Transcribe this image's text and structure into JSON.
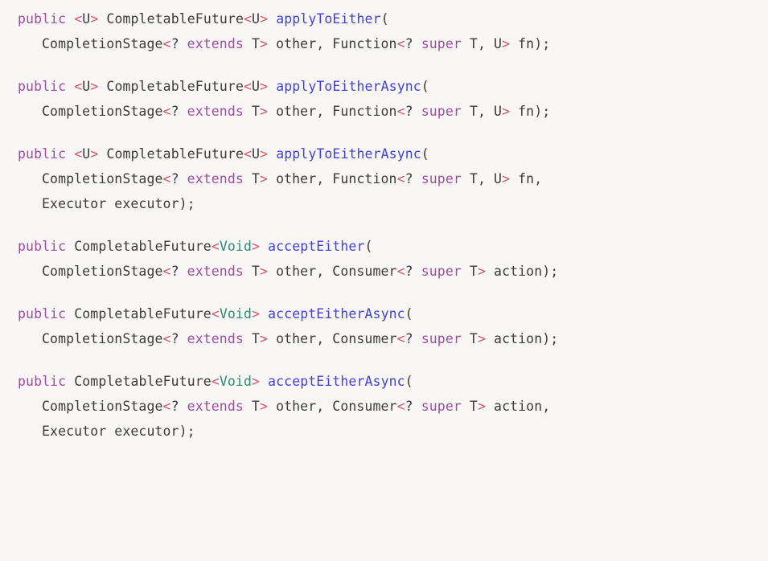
{
  "document": {
    "title": "CompletableFuture applyToEither / acceptEither API signatures",
    "language": "java",
    "background_color": "#f8f7f6"
  },
  "theme": {
    "keyword_color": "#9b4f9e",
    "method_color": "#4040dd",
    "type_color": "#3b3b3b",
    "void_color": "#2d8b74",
    "angle_bracket_color": "#d2566a",
    "plain_color": "#3b3b3b"
  },
  "blocks": [
    {
      "id": "applyToEither",
      "lines": [
        {
          "indent": false,
          "tokens": [
            {
              "t": "public",
              "k": "kw"
            },
            {
              "t": " ",
              "k": "plain"
            },
            {
              "t": "<",
              "k": "angle"
            },
            {
              "t": "U",
              "k": "type"
            },
            {
              "t": ">",
              "k": "angle"
            },
            {
              "t": " CompletableFuture",
              "k": "type"
            },
            {
              "t": "<",
              "k": "angle"
            },
            {
              "t": "U",
              "k": "type"
            },
            {
              "t": ">",
              "k": "angle"
            },
            {
              "t": " ",
              "k": "plain"
            },
            {
              "t": "applyToEither",
              "k": "method"
            },
            {
              "t": "(",
              "k": "plain"
            }
          ]
        },
        {
          "indent": true,
          "tokens": [
            {
              "t": "CompletionStage",
              "k": "type"
            },
            {
              "t": "<",
              "k": "angle"
            },
            {
              "t": "?",
              "k": "plain"
            },
            {
              "t": " ",
              "k": "plain"
            },
            {
              "t": "extends",
              "k": "kw"
            },
            {
              "t": " T",
              "k": "type"
            },
            {
              "t": ">",
              "k": "angle"
            },
            {
              "t": " other, Function",
              "k": "plain"
            },
            {
              "t": "<",
              "k": "angle"
            },
            {
              "t": "?",
              "k": "plain"
            },
            {
              "t": " ",
              "k": "plain"
            },
            {
              "t": "super",
              "k": "kw"
            },
            {
              "t": " T, U",
              "k": "type"
            },
            {
              "t": ">",
              "k": "angle"
            },
            {
              "t": " fn);",
              "k": "plain"
            }
          ]
        }
      ]
    },
    {
      "id": "applyToEitherAsync",
      "lines": [
        {
          "indent": false,
          "tokens": [
            {
              "t": "public",
              "k": "kw"
            },
            {
              "t": " ",
              "k": "plain"
            },
            {
              "t": "<",
              "k": "angle"
            },
            {
              "t": "U",
              "k": "type"
            },
            {
              "t": ">",
              "k": "angle"
            },
            {
              "t": " CompletableFuture",
              "k": "type"
            },
            {
              "t": "<",
              "k": "angle"
            },
            {
              "t": "U",
              "k": "type"
            },
            {
              "t": ">",
              "k": "angle"
            },
            {
              "t": " ",
              "k": "plain"
            },
            {
              "t": "applyToEitherAsync",
              "k": "method"
            },
            {
              "t": "(",
              "k": "plain"
            }
          ]
        },
        {
          "indent": true,
          "tokens": [
            {
              "t": "CompletionStage",
              "k": "type"
            },
            {
              "t": "<",
              "k": "angle"
            },
            {
              "t": "?",
              "k": "plain"
            },
            {
              "t": " ",
              "k": "plain"
            },
            {
              "t": "extends",
              "k": "kw"
            },
            {
              "t": " T",
              "k": "type"
            },
            {
              "t": ">",
              "k": "angle"
            },
            {
              "t": " other, Function",
              "k": "plain"
            },
            {
              "t": "<",
              "k": "angle"
            },
            {
              "t": "?",
              "k": "plain"
            },
            {
              "t": " ",
              "k": "plain"
            },
            {
              "t": "super",
              "k": "kw"
            },
            {
              "t": " T, U",
              "k": "type"
            },
            {
              "t": ">",
              "k": "angle"
            },
            {
              "t": " fn);",
              "k": "plain"
            }
          ]
        }
      ]
    },
    {
      "id": "applyToEitherAsync-executor",
      "lines": [
        {
          "indent": false,
          "tokens": [
            {
              "t": "public",
              "k": "kw"
            },
            {
              "t": " ",
              "k": "plain"
            },
            {
              "t": "<",
              "k": "angle"
            },
            {
              "t": "U",
              "k": "type"
            },
            {
              "t": ">",
              "k": "angle"
            },
            {
              "t": " CompletableFuture",
              "k": "type"
            },
            {
              "t": "<",
              "k": "angle"
            },
            {
              "t": "U",
              "k": "type"
            },
            {
              "t": ">",
              "k": "angle"
            },
            {
              "t": " ",
              "k": "plain"
            },
            {
              "t": "applyToEitherAsync",
              "k": "method"
            },
            {
              "t": "(",
              "k": "plain"
            }
          ]
        },
        {
          "indent": true,
          "tokens": [
            {
              "t": "CompletionStage",
              "k": "type"
            },
            {
              "t": "<",
              "k": "angle"
            },
            {
              "t": "?",
              "k": "plain"
            },
            {
              "t": " ",
              "k": "plain"
            },
            {
              "t": "extends",
              "k": "kw"
            },
            {
              "t": " T",
              "k": "type"
            },
            {
              "t": ">",
              "k": "angle"
            },
            {
              "t": " other, Function",
              "k": "plain"
            },
            {
              "t": "<",
              "k": "angle"
            },
            {
              "t": "?",
              "k": "plain"
            },
            {
              "t": " ",
              "k": "plain"
            },
            {
              "t": "super",
              "k": "kw"
            },
            {
              "t": " T, U",
              "k": "type"
            },
            {
              "t": ">",
              "k": "angle"
            },
            {
              "t": " fn,",
              "k": "plain"
            }
          ]
        },
        {
          "indent": true,
          "tokens": [
            {
              "t": "Executor executor);",
              "k": "plain"
            }
          ]
        }
      ]
    },
    {
      "id": "acceptEither",
      "lines": [
        {
          "indent": false,
          "tokens": [
            {
              "t": "public",
              "k": "kw"
            },
            {
              "t": " CompletableFuture",
              "k": "type"
            },
            {
              "t": "<",
              "k": "angle"
            },
            {
              "t": "Void",
              "k": "void"
            },
            {
              "t": ">",
              "k": "angle"
            },
            {
              "t": " ",
              "k": "plain"
            },
            {
              "t": "acceptEither",
              "k": "method"
            },
            {
              "t": "(",
              "k": "plain"
            }
          ]
        },
        {
          "indent": true,
          "tokens": [
            {
              "t": "CompletionStage",
              "k": "type"
            },
            {
              "t": "<",
              "k": "angle"
            },
            {
              "t": "?",
              "k": "plain"
            },
            {
              "t": " ",
              "k": "plain"
            },
            {
              "t": "extends",
              "k": "kw"
            },
            {
              "t": " T",
              "k": "type"
            },
            {
              "t": ">",
              "k": "angle"
            },
            {
              "t": " other, Consumer",
              "k": "plain"
            },
            {
              "t": "<",
              "k": "angle"
            },
            {
              "t": "?",
              "k": "plain"
            },
            {
              "t": " ",
              "k": "plain"
            },
            {
              "t": "super",
              "k": "kw"
            },
            {
              "t": " T",
              "k": "type"
            },
            {
              "t": ">",
              "k": "angle"
            },
            {
              "t": " action);",
              "k": "plain"
            }
          ]
        }
      ]
    },
    {
      "id": "acceptEitherAsync",
      "lines": [
        {
          "indent": false,
          "tokens": [
            {
              "t": "public",
              "k": "kw"
            },
            {
              "t": " CompletableFuture",
              "k": "type"
            },
            {
              "t": "<",
              "k": "angle"
            },
            {
              "t": "Void",
              "k": "void"
            },
            {
              "t": ">",
              "k": "angle"
            },
            {
              "t": " ",
              "k": "plain"
            },
            {
              "t": "acceptEitherAsync",
              "k": "method"
            },
            {
              "t": "(",
              "k": "plain"
            }
          ]
        },
        {
          "indent": true,
          "tokens": [
            {
              "t": "CompletionStage",
              "k": "type"
            },
            {
              "t": "<",
              "k": "angle"
            },
            {
              "t": "?",
              "k": "plain"
            },
            {
              "t": " ",
              "k": "plain"
            },
            {
              "t": "extends",
              "k": "kw"
            },
            {
              "t": " T",
              "k": "type"
            },
            {
              "t": ">",
              "k": "angle"
            },
            {
              "t": " other, Consumer",
              "k": "plain"
            },
            {
              "t": "<",
              "k": "angle"
            },
            {
              "t": "?",
              "k": "plain"
            },
            {
              "t": " ",
              "k": "plain"
            },
            {
              "t": "super",
              "k": "kw"
            },
            {
              "t": " T",
              "k": "type"
            },
            {
              "t": ">",
              "k": "angle"
            },
            {
              "t": " action);",
              "k": "plain"
            }
          ]
        }
      ]
    },
    {
      "id": "acceptEitherAsync-executor",
      "lines": [
        {
          "indent": false,
          "tokens": [
            {
              "t": "public",
              "k": "kw"
            },
            {
              "t": " CompletableFuture",
              "k": "type"
            },
            {
              "t": "<",
              "k": "angle"
            },
            {
              "t": "Void",
              "k": "void"
            },
            {
              "t": ">",
              "k": "angle"
            },
            {
              "t": " ",
              "k": "plain"
            },
            {
              "t": "acceptEitherAsync",
              "k": "method"
            },
            {
              "t": "(",
              "k": "plain"
            }
          ]
        },
        {
          "indent": true,
          "tokens": [
            {
              "t": "CompletionStage",
              "k": "type"
            },
            {
              "t": "<",
              "k": "angle"
            },
            {
              "t": "?",
              "k": "plain"
            },
            {
              "t": " ",
              "k": "plain"
            },
            {
              "t": "extends",
              "k": "kw"
            },
            {
              "t": " T",
              "k": "type"
            },
            {
              "t": ">",
              "k": "angle"
            },
            {
              "t": " other, Consumer",
              "k": "plain"
            },
            {
              "t": "<",
              "k": "angle"
            },
            {
              "t": "?",
              "k": "plain"
            },
            {
              "t": " ",
              "k": "plain"
            },
            {
              "t": "super",
              "k": "kw"
            },
            {
              "t": " T",
              "k": "type"
            },
            {
              "t": ">",
              "k": "angle"
            },
            {
              "t": " action,",
              "k": "plain"
            }
          ]
        },
        {
          "indent": true,
          "tokens": [
            {
              "t": "Executor executor);",
              "k": "plain"
            }
          ]
        }
      ]
    }
  ]
}
